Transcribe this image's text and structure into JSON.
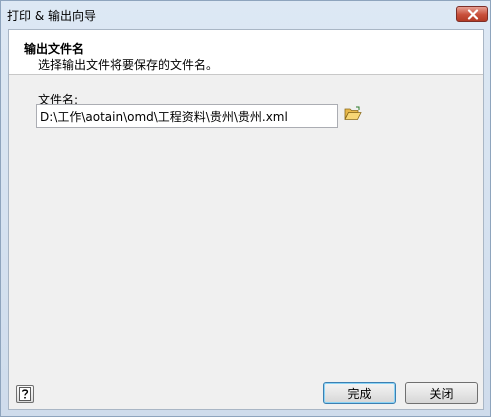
{
  "window": {
    "title": "打印 & 输出向导"
  },
  "header": {
    "title": "输出文件名",
    "subtitle": "选择输出文件将要保存的文件名。"
  },
  "form": {
    "file_label": "文件名:",
    "file_value": "D:\\工作\\aotain\\omd\\工程资料\\贵州\\贵州.xml"
  },
  "buttons": {
    "finish_label": "完成",
    "close_label": "关闭"
  },
  "icons": {
    "browse": "folder-open-icon",
    "help": "help-icon",
    "close": "close-icon"
  },
  "colors": {
    "close_button": "#c8503a",
    "default_button_border": "#3c7fb1"
  }
}
